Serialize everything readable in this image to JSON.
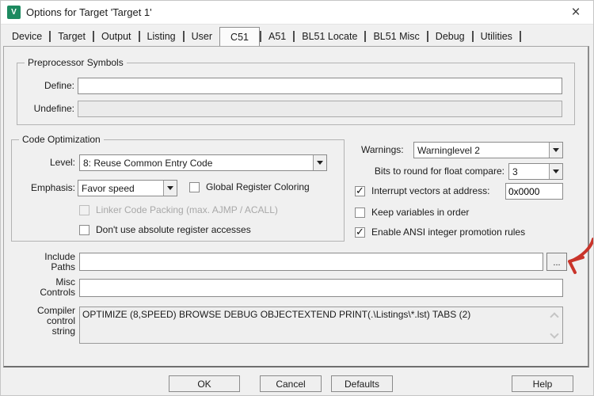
{
  "window": {
    "title": "Options for Target 'Target 1'",
    "close_glyph": "×",
    "app_icon_glyph": "V"
  },
  "tabs": [
    {
      "label": "Device",
      "active": false
    },
    {
      "label": "Target",
      "active": false
    },
    {
      "label": "Output",
      "active": false
    },
    {
      "label": "Listing",
      "active": false
    },
    {
      "label": "User",
      "active": false
    },
    {
      "label": "C51",
      "active": true
    },
    {
      "label": "A51",
      "active": false
    },
    {
      "label": "BL51 Locate",
      "active": false
    },
    {
      "label": "BL51 Misc",
      "active": false
    },
    {
      "label": "Debug",
      "active": false
    },
    {
      "label": "Utilities",
      "active": false
    }
  ],
  "preprocessor": {
    "title": "Preprocessor Symbols",
    "define_label": "Define:",
    "define_value": "",
    "undefine_label": "Undefine:",
    "undefine_value": ""
  },
  "code_optimization": {
    "title": "Code Optimization",
    "level_label": "Level:",
    "level_value": "8: Reuse Common Entry Code",
    "emphasis_label": "Emphasis:",
    "emphasis_value": "Favor speed",
    "global_register_coloring": {
      "label": "Global Register Coloring",
      "checked": false
    },
    "linker_code_packing": {
      "label": "Linker Code Packing (max. AJMP / ACALL)",
      "checked": false,
      "disabled": true
    },
    "dont_use_absolute_regs": {
      "label": "Don't use absolute register accesses",
      "checked": false
    }
  },
  "options_right": {
    "warnings_label": "Warnings:",
    "warnings_value": "Warninglevel 2",
    "float_bits_label": "Bits to round for float compare:",
    "float_bits_value": "3",
    "interrupt_vectors": {
      "label": "Interrupt vectors at address:",
      "checked": true,
      "value": "0x0000"
    },
    "keep_variables": {
      "label": "Keep variables in order",
      "checked": false
    },
    "ansi_promotion": {
      "label": "Enable ANSI integer promotion rules",
      "checked": true
    }
  },
  "paths": {
    "include_label": "Include\nPaths",
    "include_value": "",
    "browse_label": "...",
    "misc_label": "Misc\nControls",
    "misc_value": "",
    "compiler_label": "Compiler\ncontrol\nstring",
    "compiler_value": "OPTIMIZE (8,SPEED) BROWSE DEBUG OBJECTEXTEND PRINT(.\\Listings\\*.lst) TABS (2)"
  },
  "buttons": {
    "ok": "OK",
    "cancel": "Cancel",
    "defaults": "Defaults",
    "help": "Help"
  },
  "colors": {
    "annotation_arrow": "#c9342a",
    "icon_green": "#1d8a60"
  }
}
